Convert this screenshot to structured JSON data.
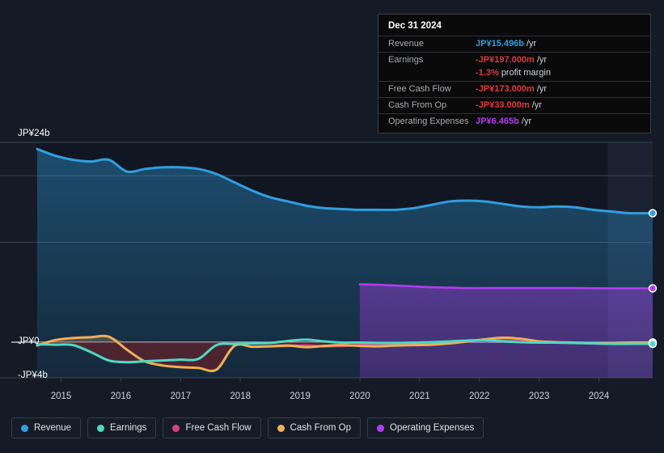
{
  "tooltip": {
    "date": "Dec 31 2024",
    "rows": [
      {
        "label": "Revenue",
        "value": "JP¥15.496b",
        "unit": "/yr",
        "color_class": "v-blue"
      },
      {
        "label": "Earnings",
        "value": "-JP¥197.000m",
        "unit": "/yr",
        "color_class": "v-red"
      },
      {
        "label": "",
        "value": "-1.3%",
        "unit": "profit margin",
        "color_class": "v-red"
      },
      {
        "label": "Free Cash Flow",
        "value": "-JP¥173.000m",
        "unit": "/yr",
        "color_class": "v-red"
      },
      {
        "label": "Cash From Op",
        "value": "-JP¥33.000m",
        "unit": "/yr",
        "color_class": "v-red"
      },
      {
        "label": "Operating Expenses",
        "value": "JP¥6.465b",
        "unit": "/yr",
        "color_class": "v-purple"
      }
    ]
  },
  "legend": {
    "items": [
      {
        "label": "Revenue",
        "color": "#2f9fe0"
      },
      {
        "label": "Earnings",
        "color": "#4fd8c4"
      },
      {
        "label": "Free Cash Flow",
        "color": "#d6407f"
      },
      {
        "label": "Cash From Op",
        "color": "#eeaf56"
      },
      {
        "label": "Operating Expenses",
        "color": "#b13df0"
      }
    ]
  },
  "axes": {
    "y_labels": [
      "JP¥24b",
      "JP¥0",
      "-JP¥4b"
    ],
    "x_labels": [
      "2015",
      "2016",
      "2017",
      "2018",
      "2019",
      "2020",
      "2021",
      "2022",
      "2023",
      "2024"
    ]
  },
  "chart_data": {
    "type": "area",
    "title": "",
    "xlabel": "",
    "ylabel": "JP¥",
    "ylim": [
      -4,
      24
    ],
    "yticks": [
      24,
      0,
      -4
    ],
    "ytick_labels": [
      "JP¥24b",
      "JP¥0",
      "-JP¥4b"
    ],
    "grid": true,
    "legend_position": "bottom-left",
    "currency": "JP¥",
    "units": "billions",
    "forecast_start_x": 2024.15,
    "x": [
      2014.6,
      2014.9,
      2015.2,
      2015.5,
      2015.8,
      2016.1,
      2016.4,
      2016.7,
      2017.0,
      2017.3,
      2017.6,
      2017.9,
      2018.2,
      2018.5,
      2018.8,
      2019.1,
      2019.4,
      2019.7,
      2020.0,
      2020.3,
      2020.6,
      2020.9,
      2021.2,
      2021.5,
      2021.8,
      2022.1,
      2022.4,
      2022.7,
      2023.0,
      2023.3,
      2023.6,
      2023.9,
      2024.2,
      2024.5,
      2024.9
    ],
    "series": [
      {
        "name": "Revenue",
        "color": "#2f9fe0",
        "fill": true,
        "values": [
          23.2,
          22.4,
          21.9,
          21.7,
          21.9,
          20.5,
          20.8,
          21.0,
          21.0,
          20.8,
          20.2,
          19.2,
          18.2,
          17.4,
          16.9,
          16.4,
          16.1,
          16.0,
          15.9,
          15.9,
          15.9,
          16.1,
          16.5,
          16.9,
          17.0,
          16.9,
          16.6,
          16.3,
          16.2,
          16.3,
          16.2,
          15.9,
          15.7,
          15.5,
          15.496
        ]
      },
      {
        "name": "Earnings",
        "color": "#4fd8c4",
        "fill": false,
        "values": [
          -0.25,
          -0.3,
          -0.35,
          -1.2,
          -2.2,
          -2.4,
          -2.3,
          -2.2,
          -2.1,
          -2.0,
          -0.35,
          -0.2,
          -0.15,
          -0.1,
          0.15,
          0.3,
          0.1,
          -0.05,
          -0.05,
          -0.1,
          -0.1,
          -0.05,
          0.0,
          0.1,
          0.2,
          0.25,
          0.1,
          0.0,
          -0.05,
          -0.05,
          -0.1,
          -0.15,
          -0.2,
          -0.2,
          -0.197
        ]
      },
      {
        "name": "Free Cash Flow",
        "color": "#d6407f",
        "fill": false,
        "start_x": 2018.6,
        "values": [
          null,
          null,
          null,
          null,
          null,
          null,
          null,
          null,
          null,
          null,
          null,
          null,
          null,
          -0.5,
          -0.45,
          -0.4,
          -0.5,
          -0.45,
          -0.35,
          -0.3,
          -0.25,
          -0.2,
          -0.15,
          -0.05,
          0.1,
          0.3,
          0.45,
          0.3,
          0.05,
          -0.05,
          -0.1,
          -0.15,
          -0.2,
          -0.18,
          -0.173
        ]
      },
      {
        "name": "Cash From Op",
        "color": "#eeaf56",
        "fill": false,
        "values": [
          -0.4,
          0.25,
          0.5,
          0.6,
          0.65,
          -0.9,
          -2.3,
          -2.8,
          -3.0,
          -3.1,
          -3.3,
          -0.45,
          -0.55,
          -0.5,
          -0.4,
          -0.6,
          -0.45,
          -0.35,
          -0.45,
          -0.5,
          -0.4,
          -0.35,
          -0.3,
          -0.15,
          0.1,
          0.35,
          0.55,
          0.4,
          0.1,
          0.0,
          -0.05,
          -0.1,
          -0.1,
          -0.05,
          -0.033
        ]
      },
      {
        "name": "Operating Expenses",
        "color": "#b13df0",
        "fill": true,
        "start_x": 2020.0,
        "values": [
          null,
          null,
          null,
          null,
          null,
          null,
          null,
          null,
          null,
          null,
          null,
          null,
          null,
          null,
          null,
          null,
          null,
          null,
          6.95,
          6.9,
          6.8,
          6.7,
          6.6,
          6.55,
          6.5,
          6.5,
          6.5,
          6.5,
          6.5,
          6.5,
          6.5,
          6.48,
          6.47,
          6.47,
          6.465
        ]
      }
    ]
  }
}
